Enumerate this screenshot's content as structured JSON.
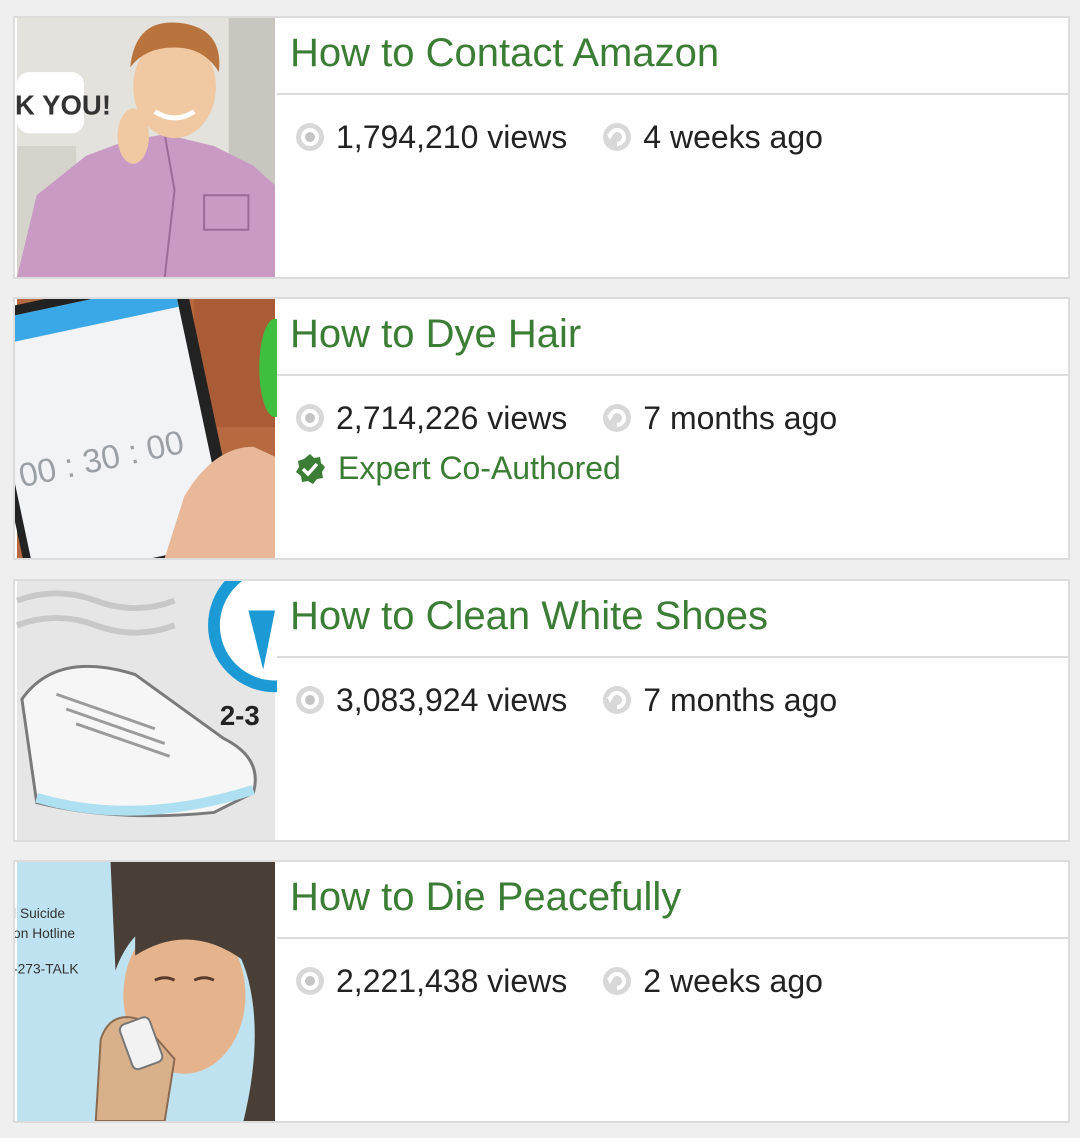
{
  "articles": [
    {
      "title": "How to Contact Amazon",
      "views": "1,794,210 views",
      "updated": "4 weeks ago",
      "thumb_text": "K YOU!"
    },
    {
      "title": "How to Dye Hair",
      "views": "2,714,226 views",
      "updated": "7 months ago",
      "badge": "Expert Co-Authored",
      "thumb_text": "00 : 30 : 00"
    },
    {
      "title": "How to Clean White Shoes",
      "views": "3,083,924 views",
      "updated": "7 months ago",
      "thumb_text": "2-3"
    },
    {
      "title": "How to Die Peacefully",
      "views": "2,221,438 views",
      "updated": "2 weeks ago",
      "thumb_lines": [
        "l Suicide",
        "on Hotline",
        "-273-TALK"
      ]
    }
  ],
  "colors": {
    "title": "#3b7d34",
    "badge": "#3b7d34",
    "icon_gray": "#c4c4c4"
  },
  "icons": {
    "views": "eye-icon",
    "updated": "refresh-icon",
    "badge": "verified-badge-icon"
  }
}
